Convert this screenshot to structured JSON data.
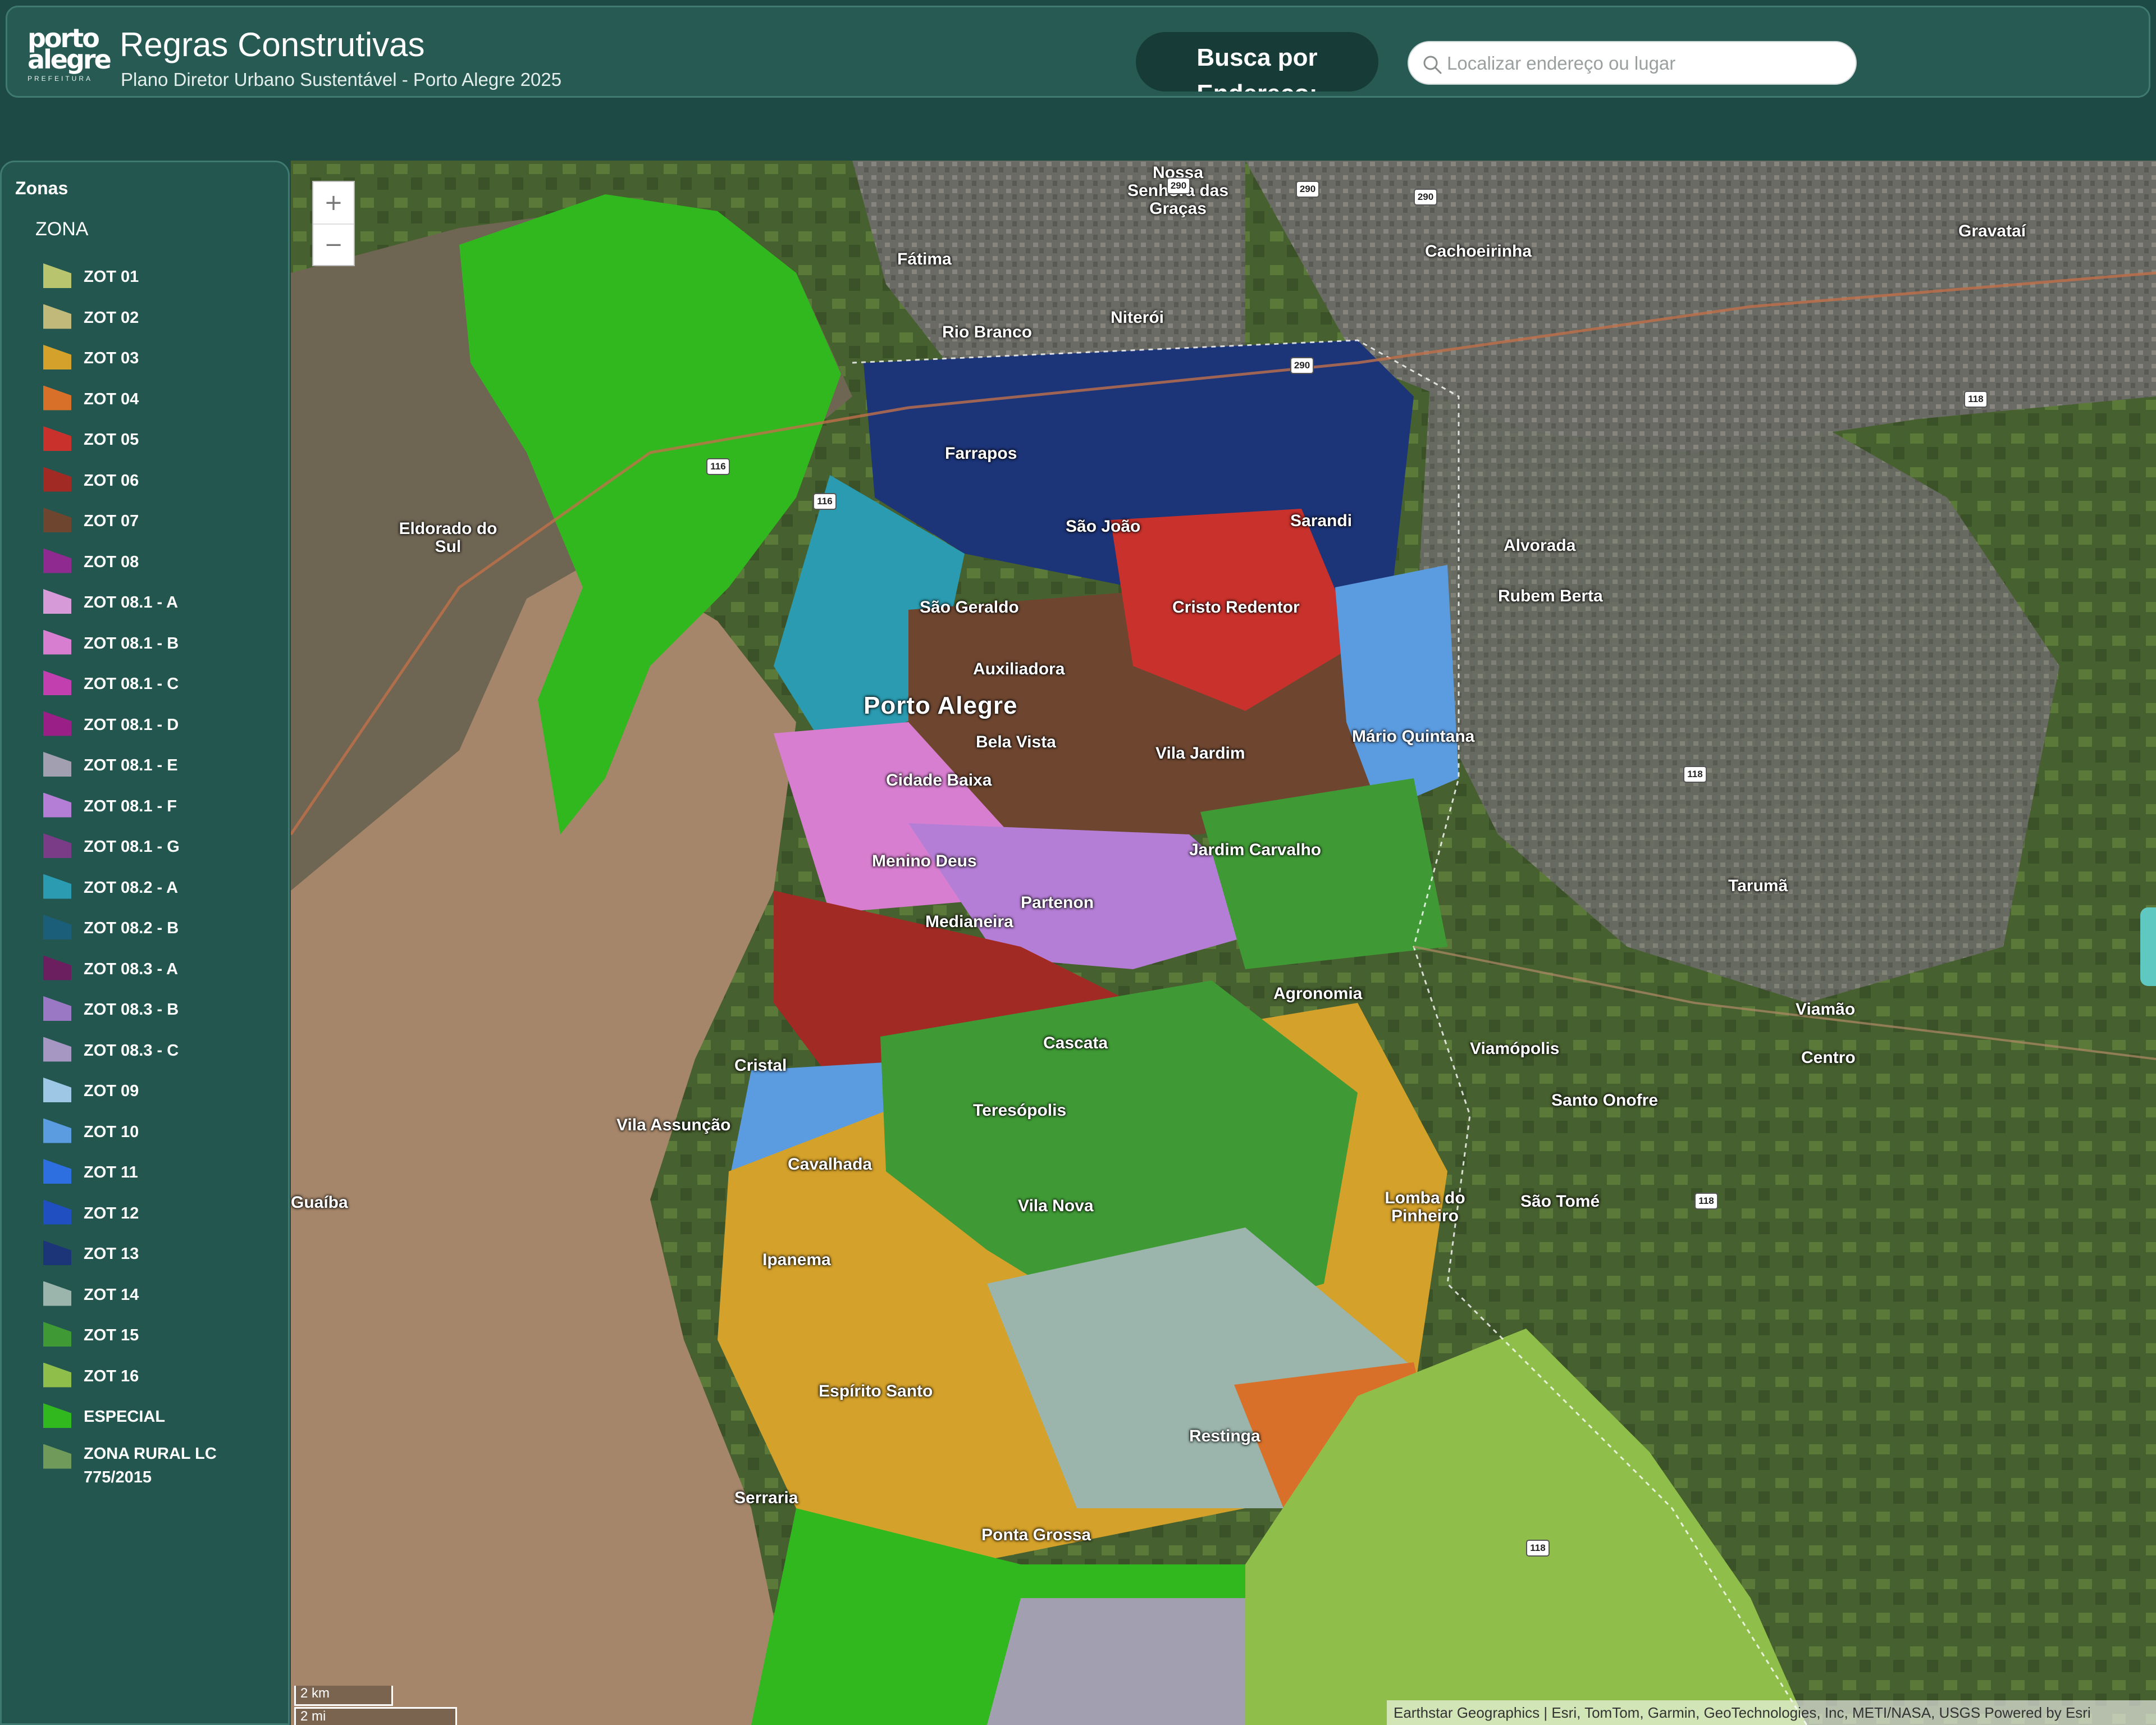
{
  "header": {
    "logo": {
      "line1": "porto",
      "line2": "alegre",
      "line3": "PREFEITURA"
    },
    "title": "Regras Construtivas",
    "subtitle": "Plano Diretor Urbano Sustentável - Porto Alegre 2025",
    "search_mode_label": "Busca por Endereço:",
    "search_placeholder": "Localizar endereço ou lugar",
    "search_icon": "search-icon"
  },
  "legend": {
    "heading": "Zonas",
    "group": "ZONA",
    "items": [
      {
        "label": "ZOT 01",
        "color": "#b9c46e"
      },
      {
        "label": "ZOT 02",
        "color": "#c1b97a"
      },
      {
        "label": "ZOT 03",
        "color": "#d4a12a"
      },
      {
        "label": "ZOT 04",
        "color": "#d8702a"
      },
      {
        "label": "ZOT 05",
        "color": "#c8312c"
      },
      {
        "label": "ZOT 06",
        "color": "#a12a24"
      },
      {
        "label": "ZOT 07",
        "color": "#6e4630"
      },
      {
        "label": "ZOT 08",
        "color": "#8e2a90"
      },
      {
        "label": "ZOT 08.1 - A",
        "color": "#d79ad8"
      },
      {
        "label": "ZOT 08.1 - B",
        "color": "#d77ed0"
      },
      {
        "label": "ZOT 08.1 - C",
        "color": "#c23fb0"
      },
      {
        "label": "ZOT 08.1 - D",
        "color": "#9a1f86"
      },
      {
        "label": "ZOT 08.1 - E",
        "color": "#a2a0b0"
      },
      {
        "label": "ZOT 08.1 - F",
        "color": "#b57ed6"
      },
      {
        "label": "ZOT 08.1 - G",
        "color": "#7a3b87"
      },
      {
        "label": "ZOT 08.2 - A",
        "color": "#2a9bb0"
      },
      {
        "label": "ZOT 08.2 - B",
        "color": "#1b5e7a"
      },
      {
        "label": "ZOT 08.3 - A",
        "color": "#6b1f5e"
      },
      {
        "label": "ZOT 08.3 - B",
        "color": "#9a78c4"
      },
      {
        "label": "ZOT 08.3 - C",
        "color": "#a596c2"
      },
      {
        "label": "ZOT 09",
        "color": "#9ec7e6"
      },
      {
        "label": "ZOT 10",
        "color": "#5b9be0"
      },
      {
        "label": "ZOT 11",
        "color": "#2d6fe0"
      },
      {
        "label": "ZOT 12",
        "color": "#1f4fc0"
      },
      {
        "label": "ZOT 13",
        "color": "#1c3478"
      },
      {
        "label": "ZOT 14",
        "color": "#9bb5ad"
      },
      {
        "label": "ZOT 15",
        "color": "#3f9a35"
      },
      {
        "label": "ZOT 16",
        "color": "#8fbf4a"
      },
      {
        "label": "ESPECIAL",
        "color": "#31b81f"
      },
      {
        "label": "ZONA RURAL LC 775/2015",
        "color": "#6f9a5a"
      }
    ]
  },
  "map": {
    "zoom_in": "+",
    "zoom_out": "−",
    "labels": [
      {
        "text": "Nossa Senhora das Graças",
        "kind": "minor"
      },
      {
        "text": "Fátima",
        "kind": "minor"
      },
      {
        "text": "Cachoeirinha",
        "kind": "minor"
      },
      {
        "text": "Gravataí",
        "kind": "minor"
      },
      {
        "text": "Niterói",
        "kind": "minor"
      },
      {
        "text": "Rio Branco",
        "kind": "minor"
      },
      {
        "text": "Farrapos",
        "kind": "minor"
      },
      {
        "text": "Eldorado do Sul",
        "kind": "minor"
      },
      {
        "text": "São João",
        "kind": "minor"
      },
      {
        "text": "Sarandi",
        "kind": "minor"
      },
      {
        "text": "Alvorada",
        "kind": "minor"
      },
      {
        "text": "Rubem Berta",
        "kind": "minor"
      },
      {
        "text": "São Geraldo",
        "kind": "minor"
      },
      {
        "text": "Cristo Redentor",
        "kind": "minor"
      },
      {
        "text": "Auxiliadora",
        "kind": "minor"
      },
      {
        "text": "Porto Alegre",
        "kind": "major"
      },
      {
        "text": "Bela Vista",
        "kind": "minor"
      },
      {
        "text": "Vila Jardim",
        "kind": "minor"
      },
      {
        "text": "Mário Quintana",
        "kind": "minor"
      },
      {
        "text": "Cidade Baixa",
        "kind": "minor"
      },
      {
        "text": "Menino Deus",
        "kind": "minor"
      },
      {
        "text": "Jardim Carvalho",
        "kind": "minor"
      },
      {
        "text": "Tarumã",
        "kind": "minor"
      },
      {
        "text": "Partenon",
        "kind": "minor"
      },
      {
        "text": "Medianeira",
        "kind": "minor"
      },
      {
        "text": "Agronomia",
        "kind": "minor"
      },
      {
        "text": "Viamão",
        "kind": "minor"
      },
      {
        "text": "Centro",
        "kind": "minor"
      },
      {
        "text": "Cascata",
        "kind": "minor"
      },
      {
        "text": "Viamópolis",
        "kind": "minor"
      },
      {
        "text": "Cristal",
        "kind": "minor"
      },
      {
        "text": "Santo Onofre",
        "kind": "minor"
      },
      {
        "text": "Teresópolis",
        "kind": "minor"
      },
      {
        "text": "Vila Assunção",
        "kind": "minor"
      },
      {
        "text": "Cavalhada",
        "kind": "minor"
      },
      {
        "text": "Lomba do Pinheiro",
        "kind": "minor"
      },
      {
        "text": "Guaíba",
        "kind": "minor"
      },
      {
        "text": "Vila Nova",
        "kind": "minor"
      },
      {
        "text": "São Tomé",
        "kind": "minor"
      },
      {
        "text": "Ipanema",
        "kind": "minor"
      },
      {
        "text": "Espírito Santo",
        "kind": "minor"
      },
      {
        "text": "Restinga",
        "kind": "minor"
      },
      {
        "text": "Serraria",
        "kind": "minor"
      },
      {
        "text": "Ponta Grossa",
        "kind": "minor"
      }
    ],
    "route_badges": [
      "290",
      "290",
      "290",
      "118",
      "116",
      "116",
      "118",
      "290",
      "118",
      "118"
    ],
    "scale": {
      "km": "2 km",
      "mi": "2 mi"
    },
    "attribution": "Earthstar Geographics | Esri, TomTom, Garmin, GeoTechnologies, Inc, METI/NASA, USGS   Powered by Esri"
  }
}
